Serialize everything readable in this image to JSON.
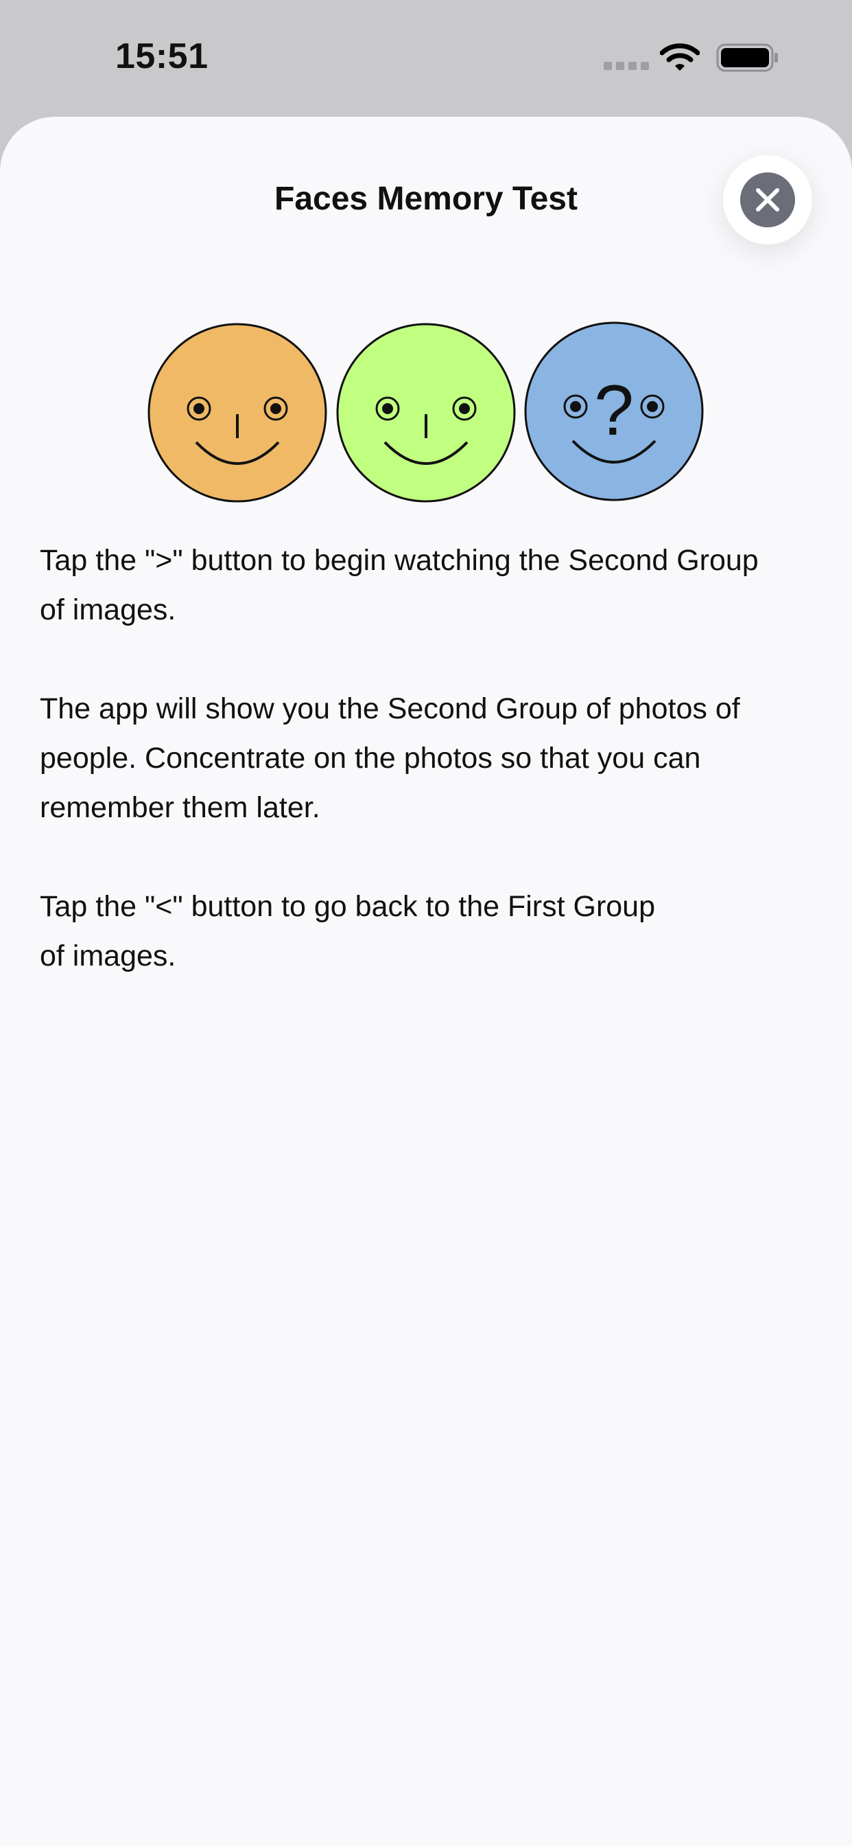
{
  "status_bar": {
    "time": "15:51",
    "icons": [
      "cellular-signal-icon",
      "wifi-icon",
      "battery-icon"
    ]
  },
  "sheet": {
    "title": "Faces Memory Test",
    "close_icon": "close-icon"
  },
  "illustration": {
    "faces": [
      {
        "name": "orange-face",
        "color": "#f0b966"
      },
      {
        "name": "green-face",
        "color": "#c0ff80"
      },
      {
        "name": "blue-face",
        "color": "#8ab4e2",
        "mark": "?"
      }
    ]
  },
  "instructions": {
    "p1_line1": "Tap the \">\" button to begin watching the Second Group",
    "p1_line2": "of images.",
    "p2_line1": "The app will show you the Second Group of photos of",
    "p2_line2": "people. Concentrate on the photos so that you can",
    "p2_line3": "remember them later.",
    "p3_line1": "Tap the \"<\" button to go back to the First Group",
    "p3_line2": "of images."
  },
  "colors": {
    "status_background": "#c9c9cc",
    "sheet_background": "#f9f9fb",
    "close_button_fill": "#6b6e78"
  }
}
